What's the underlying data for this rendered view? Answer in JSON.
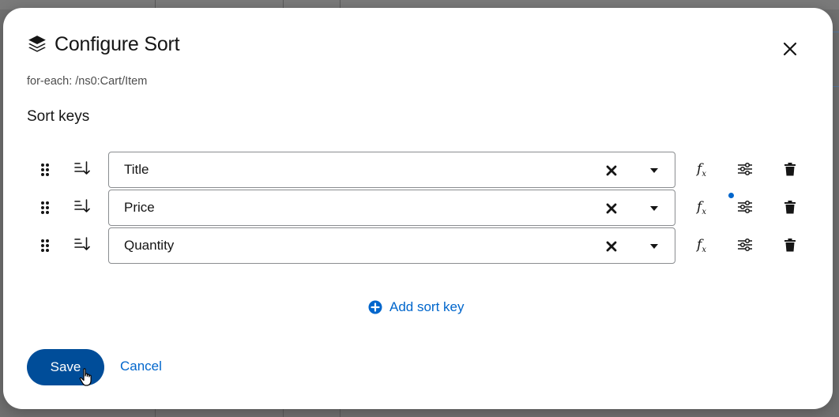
{
  "dialog": {
    "title": "Configure Sort",
    "title_icon": "layers-icon",
    "close_icon": "close-icon",
    "foreach_path": "for-each: /ns0:Cart/Item",
    "section_title": "Sort keys"
  },
  "sort_keys": [
    {
      "value": "Title",
      "options_modified": false
    },
    {
      "value": "Price",
      "options_modified": true
    },
    {
      "value": "Quantity",
      "options_modified": false
    }
  ],
  "row_icons": {
    "drag": "drag-handle-icon",
    "direction": "sort-ascending-icon",
    "clear": "clear-icon",
    "dropdown": "caret-down-icon",
    "function": "function-icon",
    "function_label": "f",
    "function_sub": "x",
    "options": "sliders-icon",
    "delete": "trash-icon"
  },
  "add_sort_key": {
    "label": "Add sort key",
    "icon": "plus-circle-icon"
  },
  "footer": {
    "save_label": "Save",
    "cancel_label": "Cancel"
  },
  "colors": {
    "primary": "#004d99",
    "link": "#0066cc",
    "text": "#151515",
    "border": "#8a8d90"
  }
}
